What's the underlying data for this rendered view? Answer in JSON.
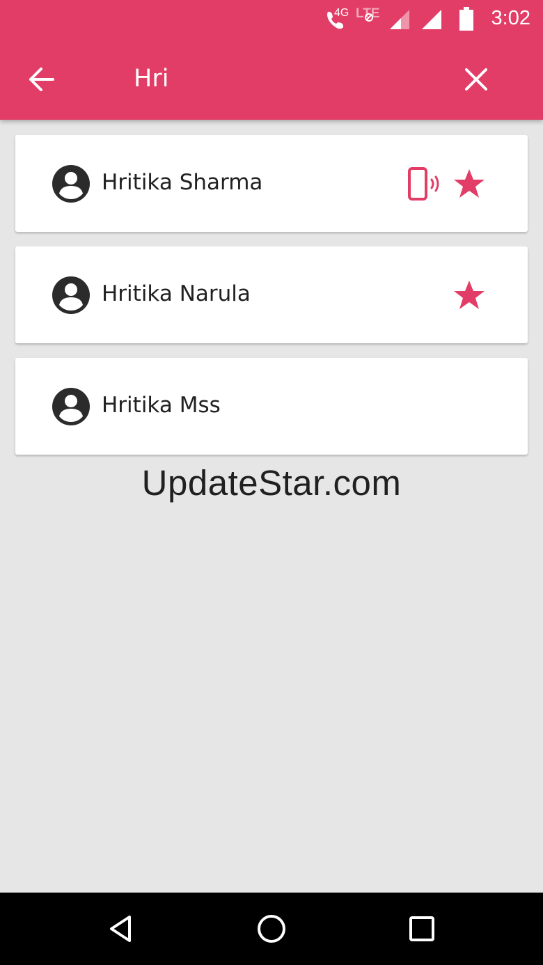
{
  "status_bar": {
    "time": "3:02",
    "network_label": "4G",
    "lte_label": "LTE",
    "icons": [
      "wifi-call-icon",
      "signal-icon",
      "signal-icon",
      "battery-icon"
    ]
  },
  "app_bar": {
    "search_value": "Hri",
    "back_icon": "arrow-back-icon",
    "clear_icon": "close-icon"
  },
  "contacts": [
    {
      "name": "Hritika Sharma",
      "icons": [
        "person-icon",
        "vibrate-icon",
        "star-icon"
      ]
    },
    {
      "name": "Hritika Narula",
      "icons": [
        "person-icon",
        "star-icon"
      ]
    },
    {
      "name": "Hritika Mss",
      "icons": [
        "person-icon"
      ]
    }
  ],
  "watermark": "UpdateStar.com",
  "nav": {
    "icons": [
      "back-triangle-icon",
      "home-circle-icon",
      "recents-square-icon"
    ]
  },
  "colors": {
    "accent": "#e23d67",
    "background": "#e6e6e6",
    "text": "#212121"
  }
}
